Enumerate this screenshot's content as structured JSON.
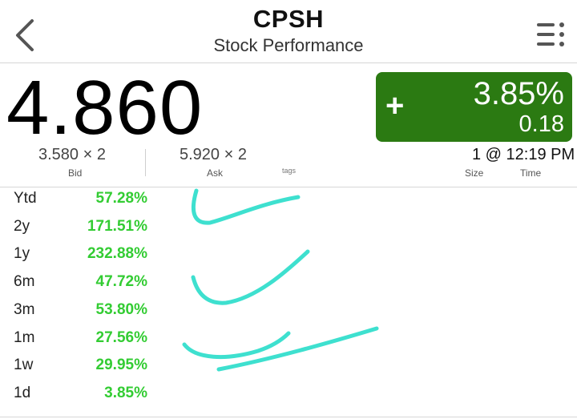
{
  "header": {
    "symbol": "CPSH",
    "subtitle": "Stock Performance"
  },
  "quote": {
    "last_price": "4.860",
    "change_sign": "+",
    "change_percent": "3.85%",
    "change_amount": "0.18",
    "change_color": "#2b7a12",
    "bid": "3.580 × 2",
    "bid_label": "Bid",
    "ask": "5.920 × 2",
    "ask_label": "Ask",
    "tags_label": "tags",
    "size_time": "1 @ 12:19 PM",
    "size_label": "Size",
    "time_label": "Time"
  },
  "performance": [
    {
      "period": "Ytd",
      "value": "57.28%"
    },
    {
      "period": "2y",
      "value": "171.51%"
    },
    {
      "period": "1y",
      "value": "232.88%"
    },
    {
      "period": "6m",
      "value": "47.72%"
    },
    {
      "period": "3m",
      "value": "53.80%"
    },
    {
      "period": "1m",
      "value": "27.56%"
    },
    {
      "period": "1w",
      "value": "29.95%"
    },
    {
      "period": "1d",
      "value": "3.85%"
    }
  ],
  "colors": {
    "positive": "#33cc33",
    "annotation_ink": "#3ee0cf"
  },
  "icons": [
    "back-chevron-icon",
    "list-menu-icon"
  ]
}
